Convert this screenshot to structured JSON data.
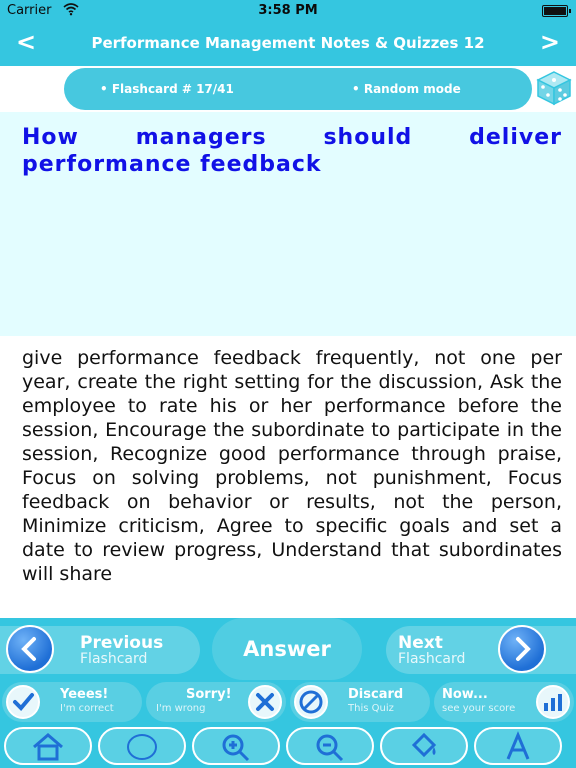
{
  "status": {
    "carrier": "Carrier",
    "time": "3:58 PM"
  },
  "nav": {
    "title": "Performance Management Notes & Quizzes 12",
    "back_glyph": "<",
    "forward_glyph": ">"
  },
  "info": {
    "counter": "• Flashcard #  17/41",
    "mode": "•  Random mode",
    "dice_icon": "dice-icon"
  },
  "card": {
    "question": "How managers should deliver performance feedback",
    "answer": "give performance feedback frequently, not one per year, create the right setting for the discussion, Ask the employee to rate his or her performance before the session, Encourage the subordinate to participate in the session, Recognize good performance through praise, Focus on solving problems, not punishment, Focus feedback on behavior or results, not the person, Minimize criticism, Agree to specific goals and set a date to review progress, Understand that subordinates will share"
  },
  "controls": {
    "previous": {
      "title": "Previous",
      "subtitle": "Flashcard"
    },
    "answer_label": "Answer",
    "next": {
      "title": "Next",
      "subtitle": "Flashcard"
    }
  },
  "scores": [
    {
      "title": "Yeees!",
      "subtitle": "I'm correct",
      "icon": "checkmark-icon"
    },
    {
      "title": "Sorry!",
      "subtitle": "I'm wrong",
      "icon": "x-icon"
    },
    {
      "title": "Discard",
      "subtitle": "This Quiz",
      "icon": "discard-icon"
    },
    {
      "title": "Now...",
      "subtitle": "see your score",
      "icon": "chart-icon"
    }
  ],
  "tools": [
    "home-icon",
    "blank-icon",
    "zoom-in-icon",
    "zoom-out-icon",
    "paint-bucket-icon",
    "font-icon"
  ],
  "colors": {
    "bar": "#35c6e0",
    "question_bg": "#e3fdff",
    "question_text": "#1111e6",
    "button_blue": "#1f6fd6"
  }
}
